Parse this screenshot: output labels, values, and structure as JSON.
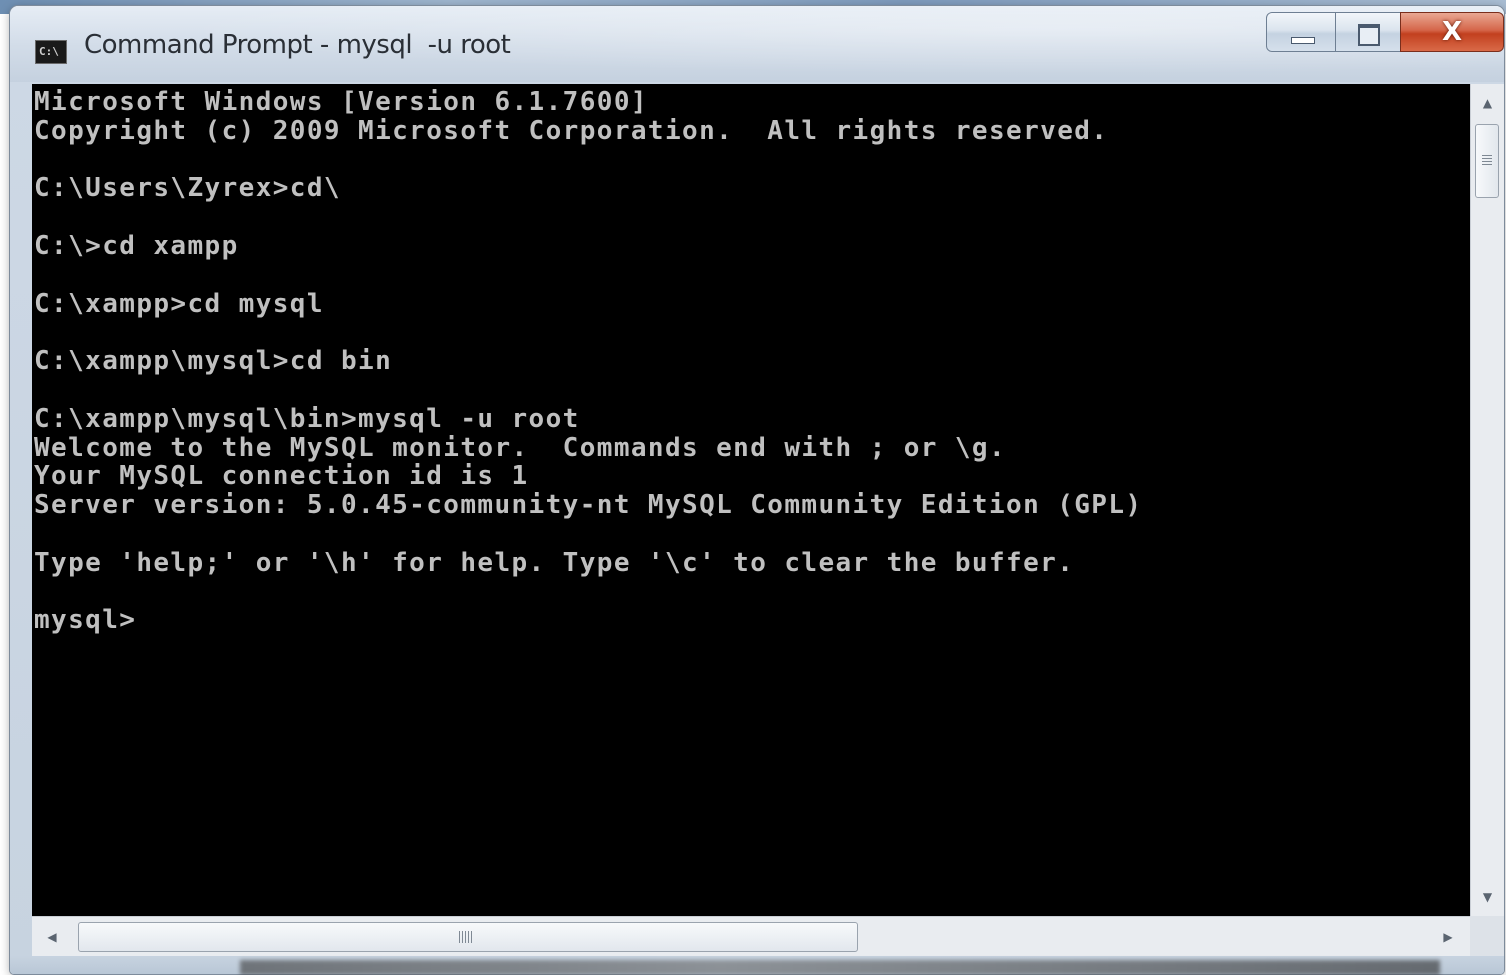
{
  "window": {
    "title": "Command Prompt - mysql  -u root",
    "icon": "cmd-icon",
    "icon_glyph": "C:\\",
    "controls": {
      "minimize_icon": "minimize-icon",
      "maximize_icon": "maximize-icon",
      "close_label": "X"
    }
  },
  "console": {
    "background": "#000000",
    "foreground": "#c0c0c0",
    "lines": [
      "Microsoft Windows [Version 6.1.7600]",
      "Copyright (c) 2009 Microsoft Corporation.  All rights reserved.",
      "",
      "C:\\Users\\Zyrex>cd\\",
      "",
      "C:\\>cd xampp",
      "",
      "C:\\xampp>cd mysql",
      "",
      "C:\\xampp\\mysql>cd bin",
      "",
      "C:\\xampp\\mysql\\bin>mysql -u root",
      "Welcome to the MySQL monitor.  Commands end with ; or \\g.",
      "Your MySQL connection id is 1",
      "Server version: 5.0.45-community-nt MySQL Community Edition (GPL)",
      "",
      "Type 'help;' or '\\h' for help. Type '\\c' to clear the buffer.",
      "",
      "mysql>"
    ]
  },
  "scrollbars": {
    "vertical": {
      "up_icon": "scroll-up-arrow-icon",
      "down_icon": "scroll-down-arrow-icon",
      "grip": "≡"
    },
    "horizontal": {
      "left_icon": "scroll-left-arrow-icon",
      "right_icon": "scroll-right-arrow-icon",
      "grip": "III"
    }
  }
}
